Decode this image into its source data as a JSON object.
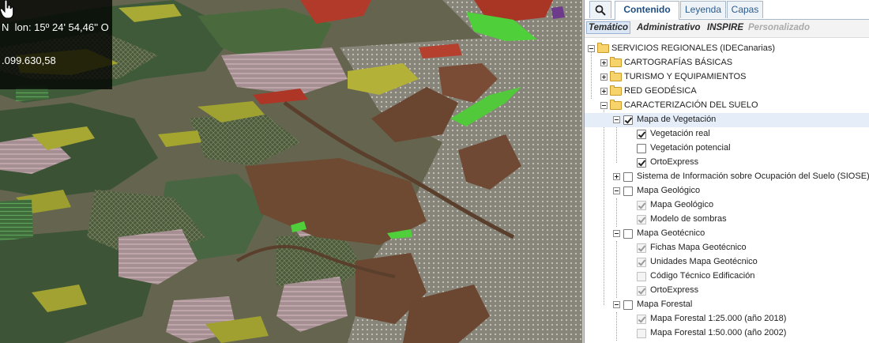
{
  "map": {
    "coord_line1": "N  lon: 15º 24' 54,46'' O",
    "coord_line2": ".099.630,58",
    "colors": {
      "background": "#6b6a58",
      "dark_green": "#3e5a38",
      "mid_green": "#4a6a3e",
      "yellow_green": "#a3a52e",
      "brown": "#6e4a32",
      "pink": "#b49ba0",
      "red": "#b23a2a",
      "bright_green": "#4fcf3a",
      "grey_urban": "#8c8a80"
    }
  },
  "tabs": {
    "search_icon": "search-icon",
    "items": [
      "Contenido",
      "Leyenda",
      "Capas"
    ],
    "active": "Contenido"
  },
  "subtabs": {
    "items": [
      "Temático",
      "Administrativo",
      "INSPIRE",
      "Personalizado"
    ],
    "active": "Temático",
    "disabled": "Personalizado"
  },
  "tree": [
    {
      "label": "SERVICIOS REGIONALES (IDECanarias)",
      "level": 0,
      "expander": "minus",
      "type": "folder"
    },
    {
      "label": "CARTOGRAFÍAS BÁSICAS",
      "level": 1,
      "expander": "plus",
      "type": "folder"
    },
    {
      "label": "TURISMO Y EQUIPAMIENTOS",
      "level": 1,
      "expander": "plus",
      "type": "folder"
    },
    {
      "label": "RED GEODÉSICA",
      "level": 1,
      "expander": "plus",
      "type": "folder"
    },
    {
      "label": "CARACTERIZACIÓN DEL SUELO",
      "level": 1,
      "expander": "minus",
      "type": "folder"
    },
    {
      "label": "Mapa de Vegetación",
      "level": 2,
      "expander": "minus",
      "type": "check",
      "checked": true,
      "highlight": true
    },
    {
      "label": "Vegetación real",
      "level": 3,
      "type": "check",
      "checked": true
    },
    {
      "label": "Vegetación potencial",
      "level": 3,
      "type": "check",
      "checked": false
    },
    {
      "label": "OrtoExpress",
      "level": 3,
      "type": "check",
      "checked": true
    },
    {
      "label": "Sistema de Información sobre Ocupación del Suelo (SIOSE)",
      "level": 2,
      "expander": "plus",
      "type": "check",
      "checked": false
    },
    {
      "label": "Mapa Geológico",
      "level": 2,
      "expander": "minus",
      "type": "check",
      "checked": false
    },
    {
      "label": "Mapa Geológico",
      "level": 3,
      "type": "check",
      "checked": true,
      "dim": true
    },
    {
      "label": "Modelo de sombras",
      "level": 3,
      "type": "check",
      "checked": true,
      "dim": true
    },
    {
      "label": "Mapa Geotécnico",
      "level": 2,
      "expander": "minus",
      "type": "check",
      "checked": false
    },
    {
      "label": "Fichas Mapa Geotécnico",
      "level": 3,
      "type": "check",
      "checked": true,
      "dim": true
    },
    {
      "label": "Unidades Mapa Geotécnico",
      "level": 3,
      "type": "check",
      "checked": true,
      "dim": true
    },
    {
      "label": "Código Técnico Edificación",
      "level": 3,
      "type": "check",
      "checked": false,
      "dim": true
    },
    {
      "label": "OrtoExpress",
      "level": 3,
      "type": "check",
      "checked": true,
      "dim": true
    },
    {
      "label": "Mapa Forestal",
      "level": 2,
      "expander": "minus",
      "type": "check",
      "checked": false
    },
    {
      "label": "Mapa Forestal 1:25.000 (año 2018)",
      "level": 3,
      "type": "check",
      "checked": true,
      "dim": true
    },
    {
      "label": "Mapa Forestal 1:50.000 (año 2002)",
      "level": 3,
      "type": "check",
      "checked": false,
      "dim": true
    }
  ]
}
